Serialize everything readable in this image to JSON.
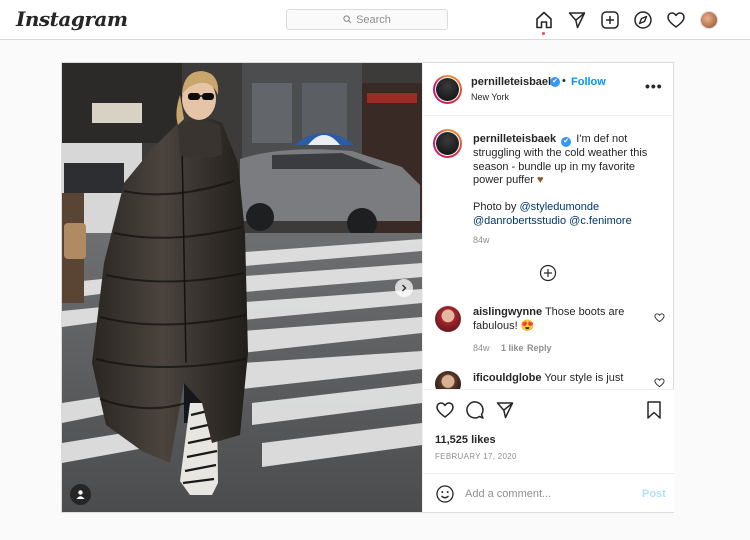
{
  "nav": {
    "logo": "Instagram",
    "search_placeholder": "Search",
    "icons": [
      "home-icon",
      "direct-icon",
      "new-post-icon",
      "explore-icon",
      "activity-icon",
      "profile-avatar"
    ]
  },
  "post": {
    "username": "pernilleteisbaek",
    "verified": "✔",
    "separator": "•",
    "follow_label": "Follow",
    "location": "New York",
    "more_label": "•••",
    "caption": {
      "username": "pernilleteisbaek",
      "text_1": "I'm def not struggling with the cold weather this season - bundle up in my favorite power puffer",
      "emoji": "♥",
      "text_2": "Photo by",
      "mention_1": "@styledumonde",
      "mention_2": "@danrobertsstudio",
      "mention_3": "@c.fenimore",
      "time": "84w"
    },
    "comments": [
      {
        "username": "aislingwynne",
        "text": "Those boots are fabulous! 😍",
        "time": "84w",
        "likes": "1 like",
        "reply": "Reply"
      },
      {
        "username": "ificouldglobe",
        "text": "Your style is just"
      }
    ],
    "likes": "11,525 likes",
    "date": "FEBRUARY 17, 2020",
    "comment_placeholder": "Add a comment...",
    "post_label": "Post"
  },
  "colors": {
    "accent": "#0095f6",
    "notification": "#ed4956",
    "verified": "#3897f0",
    "post_disabled": "#b2dffc"
  }
}
